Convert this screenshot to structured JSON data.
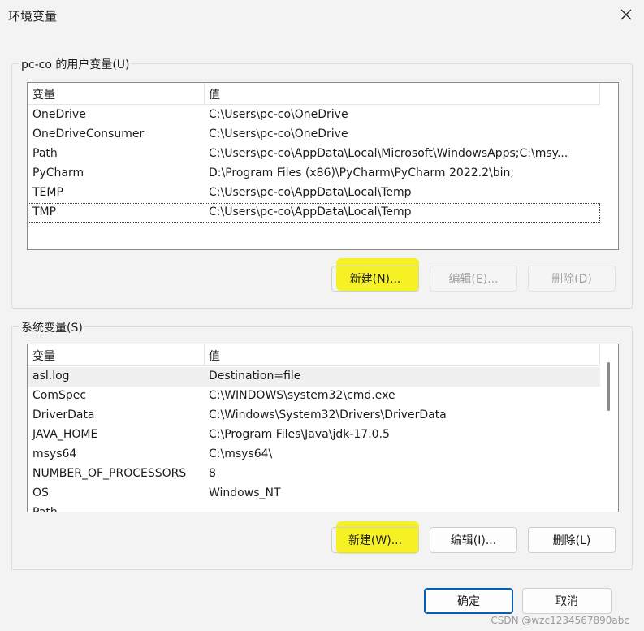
{
  "window": {
    "title": "环境变量",
    "close_icon": "close-icon"
  },
  "user_vars": {
    "legend": "pc-co 的用户变量(U)",
    "columns": [
      "变量",
      "值"
    ],
    "rows": [
      {
        "name": "OneDrive",
        "value": "C:\\Users\\pc-co\\OneDrive"
      },
      {
        "name": "OneDriveConsumer",
        "value": "C:\\Users\\pc-co\\OneDrive"
      },
      {
        "name": "Path",
        "value": "C:\\Users\\pc-co\\AppData\\Local\\Microsoft\\WindowsApps;C:\\msy..."
      },
      {
        "name": "PyCharm",
        "value": "D:\\Program Files (x86)\\PyCharm\\PyCharm 2022.2\\bin;"
      },
      {
        "name": "TEMP",
        "value": "C:\\Users\\pc-co\\AppData\\Local\\Temp"
      },
      {
        "name": "TMP",
        "value": "C:\\Users\\pc-co\\AppData\\Local\\Temp"
      }
    ],
    "buttons": {
      "new": "新建(N)...",
      "edit": "编辑(E)...",
      "delete": "删除(D)"
    }
  },
  "system_vars": {
    "legend": "系统变量(S)",
    "columns": [
      "变量",
      "值"
    ],
    "rows": [
      {
        "name": "asl.log",
        "value": "Destination=file"
      },
      {
        "name": "ComSpec",
        "value": "C:\\WINDOWS\\system32\\cmd.exe"
      },
      {
        "name": "DriverData",
        "value": "C:\\Windows\\System32\\Drivers\\DriverData"
      },
      {
        "name": "JAVA_HOME",
        "value": "C:\\Program Files\\Java\\jdk-17.0.5"
      },
      {
        "name": "msys64",
        "value": "C:\\msys64\\"
      },
      {
        "name": "NUMBER_OF_PROCESSORS",
        "value": "8"
      },
      {
        "name": "OS",
        "value": "Windows_NT"
      }
    ],
    "buttons": {
      "new": "新建(W)...",
      "edit": "编辑(I)...",
      "delete": "删除(L)"
    }
  },
  "footer": {
    "ok": "确定",
    "cancel": "取消"
  },
  "watermark": "CSDN @wzc1234567890abc",
  "colors": {
    "highlight": "#f6f000",
    "primary_border": "#005fb8"
  }
}
